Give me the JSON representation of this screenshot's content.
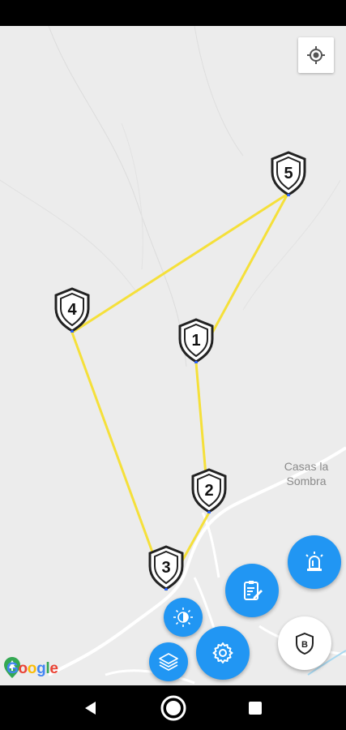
{
  "status_bar": {},
  "map": {
    "place_label_line1": "Casas la",
    "place_label_line2": "Sombra",
    "route_color": "#f5e03a",
    "waypoints": [
      {
        "label": "1"
      },
      {
        "label": "2"
      },
      {
        "label": "3"
      },
      {
        "label": "4"
      },
      {
        "label": "5"
      }
    ],
    "attribution": "Google"
  },
  "controls": {
    "locate": "my-location-icon",
    "alarm": "siren-icon",
    "checklist": "clipboard-edit-icon",
    "brightness": "brightness-icon",
    "layers": "layers-icon",
    "settings": "gear-icon",
    "shield_b": "shield-b-icon"
  },
  "colors": {
    "fab_blue": "#2196f3",
    "map_bg": "#ececec"
  },
  "nav_bar": {
    "back": "back-triangle-icon",
    "home": "home-circle-icon",
    "recents": "recents-square-icon"
  }
}
